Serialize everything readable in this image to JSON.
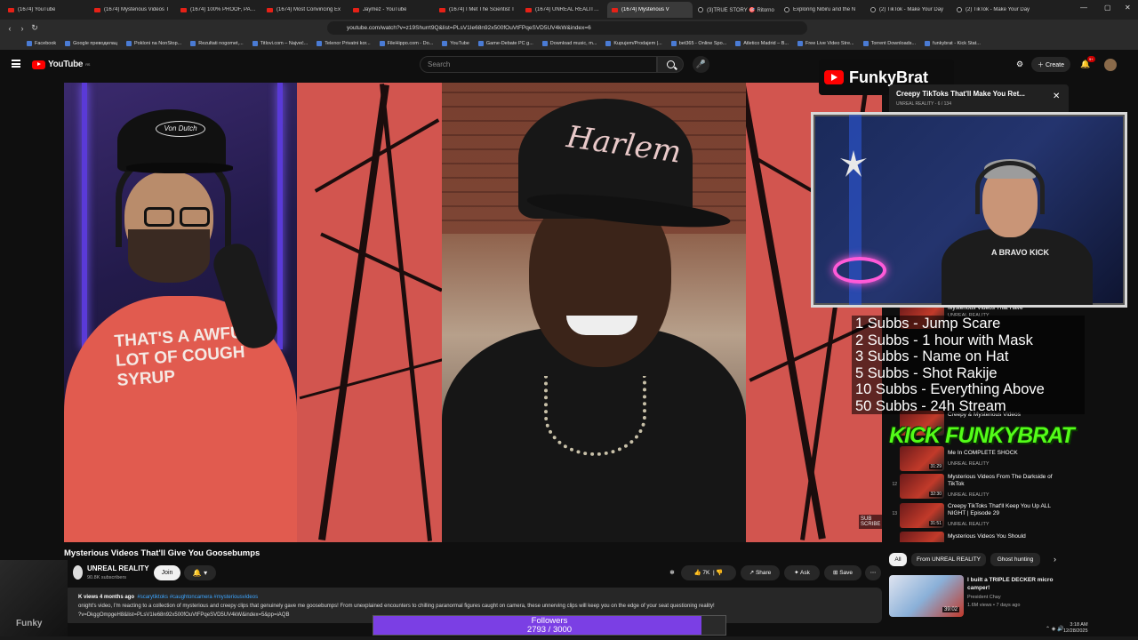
{
  "browser": {
    "tabs": [
      {
        "title": "(1674) YouTube",
        "icon": "yt"
      },
      {
        "title": "(1674) Mysterious Videos T",
        "icon": "yt"
      },
      {
        "title": "(1674) 100% PROOF, PARA",
        "icon": "yt"
      },
      {
        "title": "(1674) Most Convincing Ex",
        "icon": "yt"
      },
      {
        "title": "Jaymez - YouTube",
        "icon": "yt"
      },
      {
        "title": "(1674) I Met The Scientist T",
        "icon": "yt"
      },
      {
        "title": "(1674) UNREAL REALITY - Y",
        "icon": "yt"
      },
      {
        "title": "(1674) Mysterious V",
        "icon": "yt",
        "active": true
      },
      {
        "title": "(3)TRUE STORY 🎯 Ritorno",
        "icon": "tt"
      },
      {
        "title": "Exploring Nibiru and the N",
        "icon": "tt"
      },
      {
        "title": "(2) TikTok - Make Your Day",
        "icon": "tt"
      },
      {
        "title": "(2) TikTok - Make Your Day",
        "icon": "tt"
      }
    ],
    "url": "youtube.com/watch?v=z19Shurrt9Q&list=PLsV1Ie68n92x500fOuVtFPqeSVD5UV4kW&index=6",
    "bookmarks": [
      "Facebook",
      "Google преводилац",
      "Pokloni na NonStop...",
      "Rezultati nogomet,...",
      "Titlovi.com – Najveć...",
      "Telenor Privatni kor...",
      "FileHippo.com - Do...",
      "YouTube",
      "Game-Debate PC g...",
      "Download music, m...",
      "Kupujem/Prodajem |...",
      "bet365 - Online Spo...",
      "Atletico Madrid – B...",
      "Free Live Video Stre...",
      "Torrent Downloads...",
      "funkybrat - Kick Stat..."
    ]
  },
  "youtube": {
    "logo_text": "YouTube",
    "logo_region": "RS",
    "search_placeholder": "Search",
    "create_label": "Create",
    "notif_count": "9+"
  },
  "overlay": {
    "brand": "FunkyBrat",
    "mini_title": "Creepy TikToks That'll Make You Ret...",
    "mini_sub": "UNREAL REALITY - 6 / 134",
    "sub_goals": [
      "1 Subbs - Jump Scare",
      "2 Subbs - 1 hour with Mask",
      "3 Subbs - Name on Hat",
      "5 Subbs - Shot Rakije",
      "10 Subbs - Everything Above",
      "50 Subbs - 24h Stream"
    ],
    "kick_logo": "KICK FUNKYBRAT",
    "followers_label": "Followers",
    "followers_count": "2793 / 3000",
    "followers_current": 2793,
    "followers_goal": 3000
  },
  "video": {
    "hat_text_left": "Von Dutch",
    "shirt_text": "THAT'S A AWFUL LOT OF COUGH SYRUP",
    "hat_text_main": "Harlem",
    "cam_shirt_text": "A BRAVO KICK",
    "corner_text": "SUB SCRIBE",
    "title": "Mysterious Videos That'll Give You Goosebumps",
    "channel": "UNREAL REALITY",
    "subscribers": "90.8K subscribers",
    "join_label": "Join",
    "likes": "7K",
    "share_label": "Share",
    "ask_label": "Ask",
    "save_label": "Save",
    "desc_meta": "K views  4 months ago",
    "desc_tags": "#scarytiktoks #caughtoncamera #mysteriousvideos",
    "desc_text": "onight's video, I'm reacting to a collection of mysterious and creepy clips that genuinely gave me goosebumps! From unexplained encounters to chilling paranormal figures caught on camera, these unnerving clips will keep you on the edge of your seat questioning reality!",
    "desc_link": "?v=DkggOmpgeH8&list=PLsV1Ie68n92x500fOuVtFPqeSVD5UV4kW&index=5&pp=iAQB",
    "streamer_corner": "Funky"
  },
  "playlist": {
    "items": [
      {
        "num": "",
        "title": "Mysterious Videos That Have",
        "channel": "UNREAL REALITY",
        "dur": ""
      },
      {
        "num": "",
        "title": "Creepy & Mysterious Videos",
        "channel": "",
        "dur": ""
      },
      {
        "num": "",
        "title": "Me In COMPLETE SHOCK",
        "channel": "UNREAL REALITY",
        "dur": "31:29"
      },
      {
        "num": "12",
        "title": "Mysterious Videos From The Darkside of TikTok",
        "channel": "UNREAL REALITY",
        "dur": "32:30"
      },
      {
        "num": "13",
        "title": "Creepy TikToks That'll Keep You Up ALL NIGHT | Episode 29",
        "channel": "UNREAL REALITY",
        "dur": "31:51"
      },
      {
        "num": "",
        "title": "Mysterious Videos You Should",
        "channel": "",
        "dur": ""
      }
    ]
  },
  "chips": [
    "All",
    "From UNREAL REALITY",
    "Ghost hunting"
  ],
  "recommended": {
    "title": "I built a TRIPLE DECKER micro camper!",
    "channel": "President Chay",
    "meta": "1.6M views • 7 days ago",
    "duration": "39:02"
  },
  "system": {
    "time": "3:18 AM",
    "date": "12/28/2025"
  }
}
